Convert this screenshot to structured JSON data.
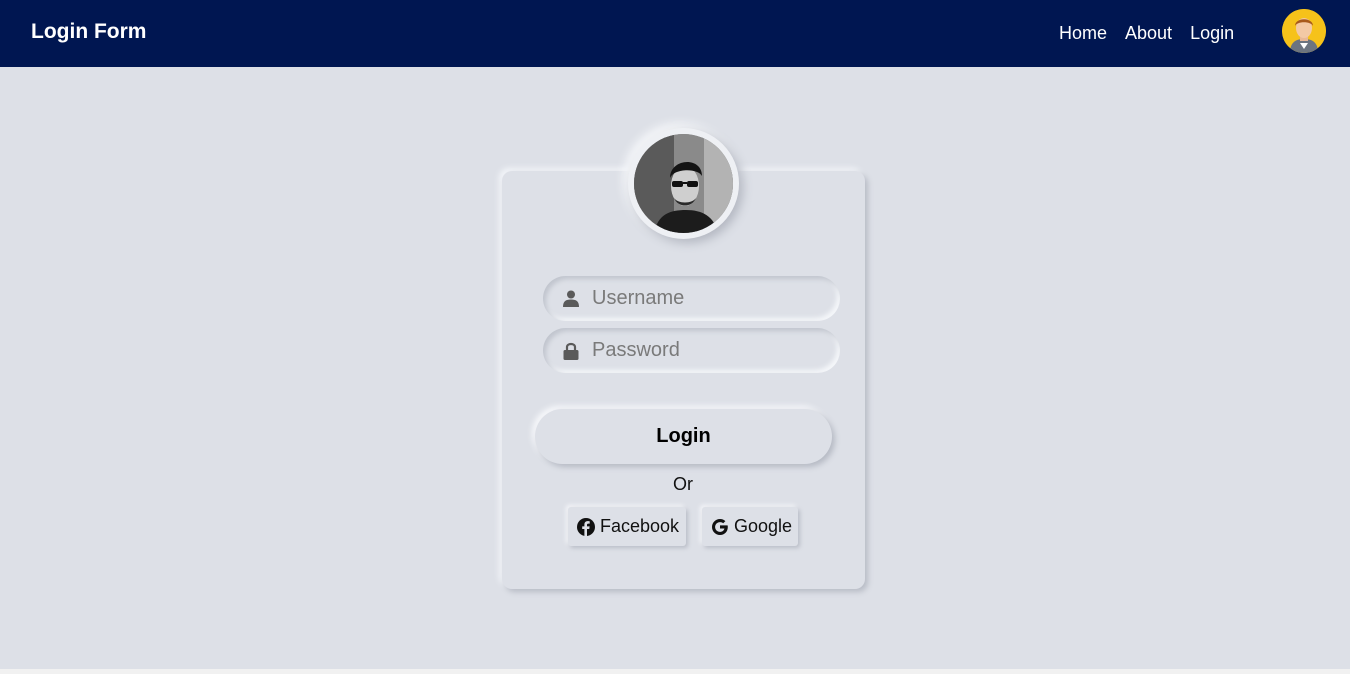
{
  "navbar": {
    "brand": "Login Form",
    "links": [
      "Home",
      "About",
      "Login"
    ],
    "avatar_icon": "user-avatar-icon",
    "background": "#001651"
  },
  "form": {
    "profile_icon": "profile-photo",
    "username": {
      "placeholder": "Username",
      "value": "",
      "icon": "user-icon"
    },
    "password": {
      "placeholder": "Password",
      "value": "",
      "icon": "lock-icon"
    },
    "login_label": "Login",
    "or_text": "Or",
    "social": [
      {
        "label": "Facebook",
        "icon": "facebook-icon"
      },
      {
        "label": "Google",
        "icon": "google-icon"
      }
    ]
  },
  "colors": {
    "page_bg": "#dde0e7",
    "accent_avatar": "#f6c21a"
  }
}
